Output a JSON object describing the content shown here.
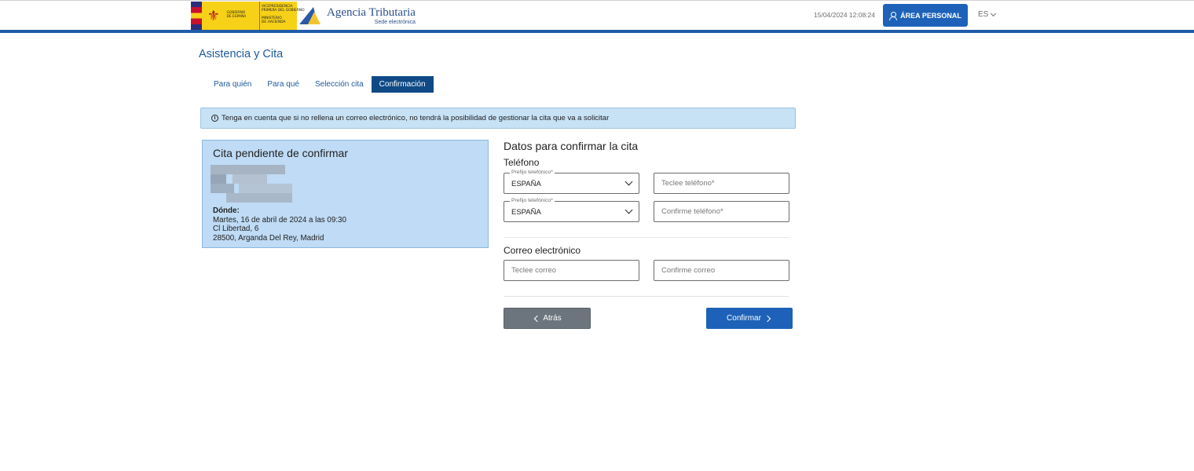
{
  "header": {
    "gov_logo_text_a": "GOBIERNO\nDE ESPAÑA",
    "gov_logo_text_b": "VICEPRESIDENCIA\nPRIMERA DEL GOBIERNO\n\nMINISTERIO\nDE HACIENDA",
    "aeat_name": "Agencia Tributaria",
    "aeat_sub": "Sede electrónica",
    "datetime": "15/04/2024 12:08:24",
    "personal_area_label": "ÁREA PERSONAL",
    "language": "ES",
    "brand_color": "#1d62b8"
  },
  "page": {
    "title": "Asistencia y Cita"
  },
  "tabs": [
    {
      "label": "Para quién",
      "active": false
    },
    {
      "label": "Para qué",
      "active": false
    },
    {
      "label": "Selección cita",
      "active": false
    },
    {
      "label": "Confirmación",
      "active": true
    }
  ],
  "info": {
    "text": "Tenga en cuenta que si no rellena un correo electrónico, no tendrá la posibilidad de gestionar la cita que va a solicitar"
  },
  "card": {
    "title": "Cita pendiente de confirmar",
    "where_label": "Dónde:",
    "date_line": "Martes, 16 de abril de 2024 a las 09:30",
    "address_line1": "Cl Libertad, 6",
    "address_line2": "28500, Arganda Del Rey, Madrid"
  },
  "form": {
    "title": "Datos para confirmar la cita",
    "phone_section": "Teléfono",
    "prefix_label": "Prefijo telefónico*",
    "prefix_value": "ESPAÑA",
    "prefix_confirm_label": "Prefijo telefónico*",
    "prefix_confirm_value": "ESPAÑA",
    "phone_placeholder": "Teclee teléfono*",
    "phone_confirm_placeholder": "Confirme teléfono*",
    "email_section": "Correo electrónico",
    "email_placeholder": "Teclee correo",
    "email_confirm_placeholder": "Confirme correo",
    "back_label": "Atrás",
    "confirm_label": "Confirmar"
  }
}
